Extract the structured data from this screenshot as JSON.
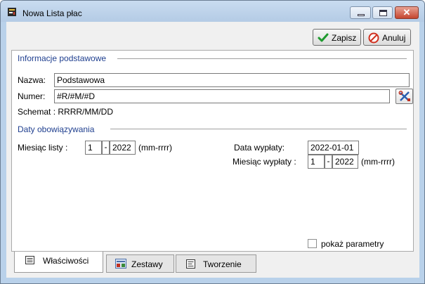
{
  "window": {
    "title": "Nowa Lista płac"
  },
  "toolbar": {
    "save_label": "Zapisz",
    "cancel_label": "Anuluj"
  },
  "basic": {
    "section_title": "Informacje podstawowe",
    "name_label": "Nazwa:",
    "name_value": "Podstawowa",
    "number_label": "Numer:",
    "number_value": "#R/#M/#D",
    "scheme_text": "Schemat : RRRR/MM/DD"
  },
  "dates": {
    "section_title": "Daty obowiązywania",
    "list_month_label": "Miesiąc listy :",
    "list_month": "1",
    "list_year": "2022",
    "format_hint": "(mm-rrrr)",
    "payout_date_label": "Data wypłaty:",
    "payout_date": "2022-01-01",
    "payout_month_label": "Miesiąc wypłaty :",
    "payout_month": "1",
    "payout_year": "2022",
    "separator": "-"
  },
  "options": {
    "show_params_label": "pokaż parametry",
    "show_params_checked": false
  },
  "tabs": [
    {
      "label": "Właściwości",
      "icon": "properties-icon",
      "active": true
    },
    {
      "label": "Zestawy",
      "icon": "sets-icon",
      "active": false
    },
    {
      "label": "Tworzenie",
      "icon": "document-icon",
      "active": false
    }
  ],
  "colors": {
    "section_title": "#1f3f8f",
    "titlebar": "#b9d1ea",
    "close_button": "#c5452f"
  }
}
